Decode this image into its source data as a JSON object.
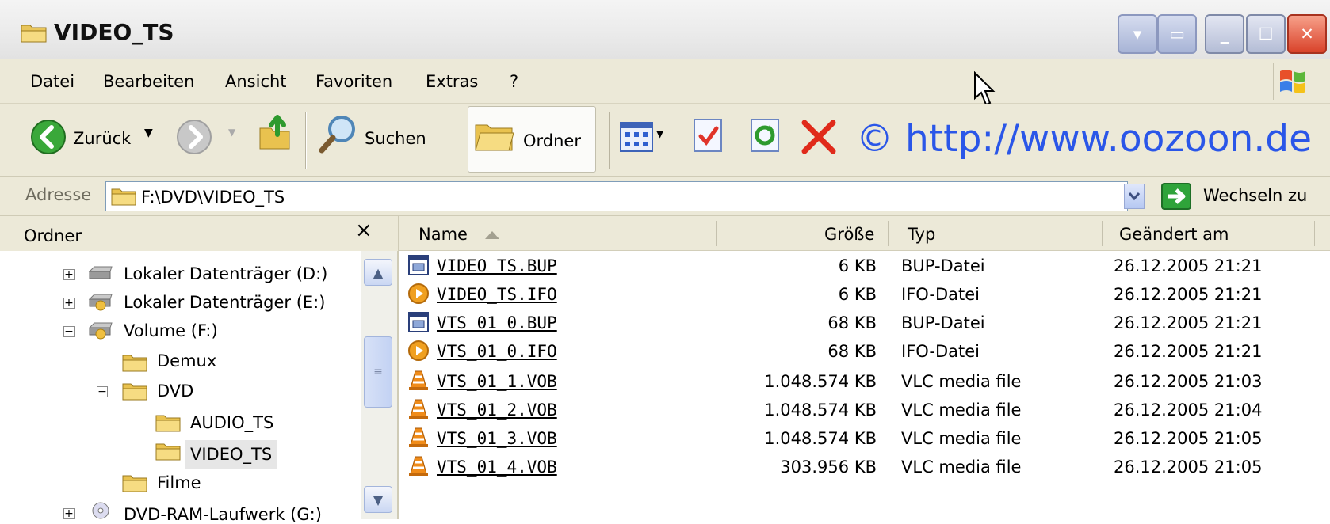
{
  "window": {
    "title": "VIDEO_TS"
  },
  "menu": [
    "Datei",
    "Bearbeiten",
    "Ansicht",
    "Favoriten",
    "Extras",
    "?"
  ],
  "toolbar": {
    "back_label": "Zurück",
    "search_label": "Suchen",
    "folders_label": "Ordner",
    "watermark": "© http://www.oozoon.de"
  },
  "address": {
    "label": "Adresse",
    "path": "F:\\DVD\\VIDEO_TS",
    "go_label": "Wechseln zu"
  },
  "folder_pane": {
    "title": "Ordner",
    "close": "×",
    "tree": [
      {
        "label": "Lokaler Datenträger (D:)",
        "expander": "+",
        "icon": "drive-icon"
      },
      {
        "label": "Lokaler Datenträger (E:)",
        "expander": "+",
        "icon": "drive-icon"
      },
      {
        "label": "Volume (F:)",
        "expander": "−",
        "icon": "drive-icon"
      },
      {
        "label": "Demux",
        "expander": "",
        "icon": "folder-icon"
      },
      {
        "label": "DVD",
        "expander": "−",
        "icon": "folder-icon"
      },
      {
        "label": "AUDIO_TS",
        "expander": "",
        "icon": "folder-icon"
      },
      {
        "label": "VIDEO_TS",
        "expander": "",
        "icon": "folder-icon",
        "selected": true
      },
      {
        "label": "Filme",
        "expander": "",
        "icon": "folder-icon"
      },
      {
        "label": "DVD-RAM-Laufwerk (G:)",
        "expander": "+",
        "icon": "dvd-drive-icon"
      }
    ]
  },
  "columns": {
    "name": "Name",
    "size": "Größe",
    "type": "Typ",
    "modified": "Geändert am"
  },
  "files": [
    {
      "name": "VIDEO_TS.BUP",
      "size": "6 KB",
      "type": "BUP-Datei",
      "modified": "26.12.2005 21:21",
      "icon": "bup-file-icon"
    },
    {
      "name": "VIDEO_TS.IFO",
      "size": "6 KB",
      "type": "IFO-Datei",
      "modified": "26.12.2005 21:21",
      "icon": "ifo-file-icon"
    },
    {
      "name": "VTS_01_0.BUP",
      "size": "68 KB",
      "type": "BUP-Datei",
      "modified": "26.12.2005 21:21",
      "icon": "bup-file-icon"
    },
    {
      "name": "VTS_01_0.IFO",
      "size": "68 KB",
      "type": "IFO-Datei",
      "modified": "26.12.2005 21:21",
      "icon": "ifo-file-icon"
    },
    {
      "name": "VTS_01_1.VOB",
      "size": "1.048.574 KB",
      "type": "VLC media file",
      "modified": "26.12.2005 21:03",
      "icon": "vlc-cone-icon"
    },
    {
      "name": "VTS_01_2.VOB",
      "size": "1.048.574 KB",
      "type": "VLC media file",
      "modified": "26.12.2005 21:04",
      "icon": "vlc-cone-icon"
    },
    {
      "name": "VTS_01_3.VOB",
      "size": "1.048.574 KB",
      "type": "VLC media file",
      "modified": "26.12.2005 21:05",
      "icon": "vlc-cone-icon"
    },
    {
      "name": "VTS_01_4.VOB",
      "size": "303.956 KB",
      "type": "VLC media file",
      "modified": "26.12.2005 21:05",
      "icon": "vlc-cone-icon"
    }
  ],
  "colors": {
    "accent_link": "#2a56e8",
    "xp_chrome": "#ece9d8",
    "close_red": "#d9432a"
  }
}
